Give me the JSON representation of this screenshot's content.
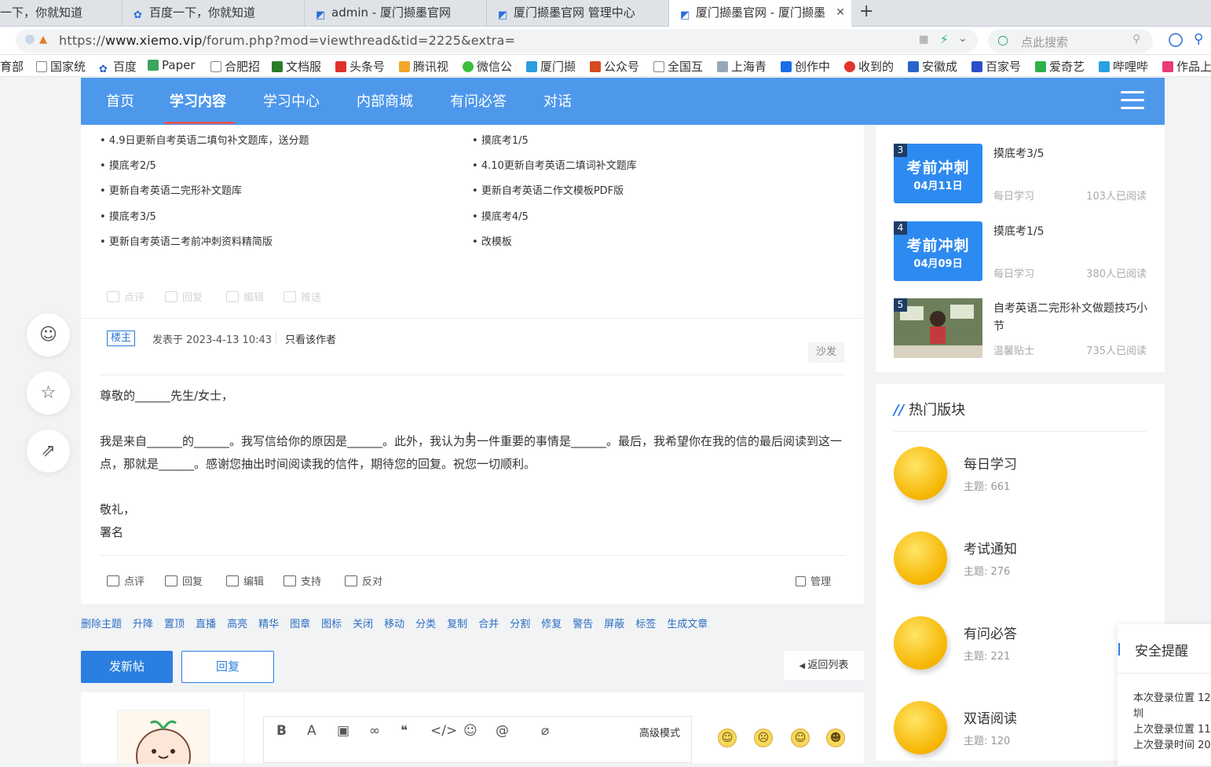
{
  "browser": {
    "tabs": [
      {
        "label": "一下，你就知道"
      },
      {
        "label": "百度一下，你就知道"
      },
      {
        "label": "admin - 厦门撷墨官网"
      },
      {
        "label": "厦门撷墨官网 管理中心"
      },
      {
        "label": "厦门撷墨官网 - 厦门撷墨"
      }
    ],
    "url_prefix": "https://",
    "url_host": "www.xiemo.vip",
    "url_path": "/forum.php?mod=viewthread&tid=2225&extra=",
    "search_placeholder": "点此搜索",
    "bookmarks": [
      "育部",
      "国家统",
      "百度",
      "Paper",
      "合肥招",
      "文档服",
      "头条号",
      "腾讯视",
      "微信公",
      "厦门撷",
      "公众号",
      "全国互",
      "上海青",
      "创作中",
      "收到的",
      "安徽成",
      "百家号",
      "爱奇艺",
      "哔哩哔",
      "作品上"
    ]
  },
  "nav": {
    "items": [
      "首页",
      "学习内容",
      "学习中心",
      "内部商城",
      "有问必答",
      "对话"
    ],
    "active_index": 1
  },
  "related_list": {
    "left": [
      "4.9日更新自考英语二填句补文题库，送分题",
      "摸底考2/5",
      "更新自考英语二完形补文题库",
      "摸底考3/5",
      "更新自考英语二考前冲刺资料精简版"
    ],
    "right": [
      "摸底考1/5",
      "4.10更新自考英语二填词补文题库",
      "更新自考英语二作文模板PDF版",
      "摸底考4/5",
      "改模板"
    ]
  },
  "actions": {
    "comment": "点评",
    "reply": "回复",
    "edit": "编辑",
    "push": "推送",
    "support": "支持",
    "oppose": "反对",
    "manage": "管理"
  },
  "post": {
    "badge": "楼主",
    "posted_at": "发表于 2023-4-13 10:43",
    "only_author": "只看该作者",
    "floor": "沙发",
    "greeting": "尊敬的______先生/女士，",
    "body": "我是来自______的______。我写信给你的原因是______。此外，我认为另一件重要的事情是______。最后，我希望你在我的信的最后阅读到这一点，那就是______。感谢您抽出时间阅读我的信件，期待您的回复。祝您一切顺利。",
    "closing": "敬礼，",
    "signature": "署名"
  },
  "admin_links": [
    "删除主题",
    "升降",
    "置顶",
    "直播",
    "高亮",
    "精华",
    "图章",
    "图标",
    "关闭",
    "移动",
    "分类",
    "复制",
    "合并",
    "分割",
    "修复",
    "警告",
    "屏蔽",
    "标签",
    "生成文章"
  ],
  "buttons": {
    "new_post": "发新帖",
    "reply": "回复",
    "back": "返回列表"
  },
  "editor": {
    "advanced_mode": "高级模式"
  },
  "sidebar_articles": [
    {
      "rank": "3",
      "thumb_big": "考前冲刺",
      "thumb_small": "04月11日",
      "title": "摸底考3/5",
      "category": "每日学习",
      "reads": "103人已阅读"
    },
    {
      "rank": "4",
      "thumb_big": "考前冲刺",
      "thumb_small": "04月09日",
      "title": "摸底考1/5",
      "category": "每日学习",
      "reads": "380人已阅读"
    },
    {
      "rank": "5",
      "thumb_big": "",
      "thumb_small": "",
      "title": "自考英语二完形补文做题技巧小节",
      "category": "温馨贴士",
      "reads": "735人已阅读"
    }
  ],
  "hot_forums": {
    "title": "热门版块",
    "items": [
      {
        "name": "每日学习",
        "count": "主题: 661"
      },
      {
        "name": "考试通知",
        "count": "主题: 276"
      },
      {
        "name": "有问必答",
        "count": "主题: 221"
      },
      {
        "name": "双语阅读",
        "count": "主题: 120"
      }
    ]
  },
  "security": {
    "title": "安全提醒",
    "lines": [
      "本次登录位置 12",
      "圳",
      "上次登录位置 11",
      "上次登录时间 20"
    ]
  },
  "colors": {
    "nav_bg": "#4e98ec",
    "accent": "#2b7fe0",
    "nav_underline": "#e05a5a"
  }
}
